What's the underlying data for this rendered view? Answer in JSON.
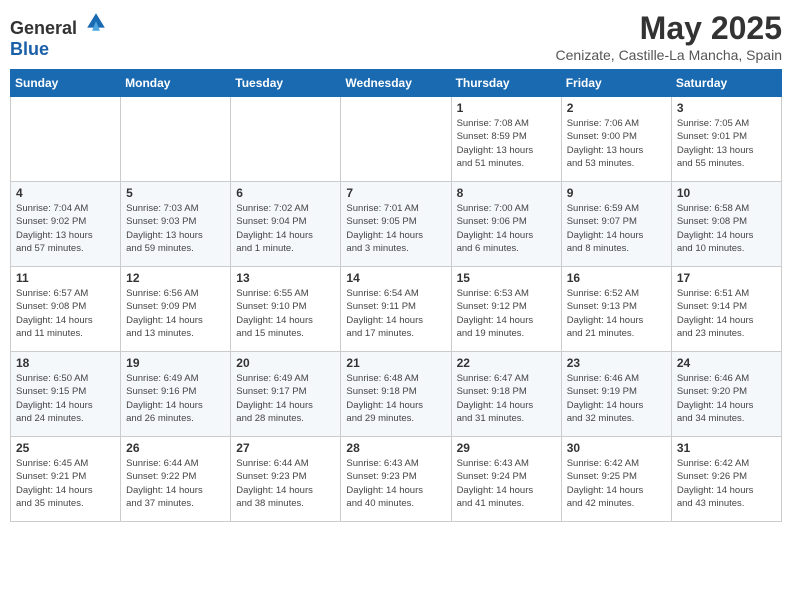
{
  "logo": {
    "general": "General",
    "blue": "Blue"
  },
  "title": "May 2025",
  "location": "Cenizate, Castille-La Mancha, Spain",
  "weekdays": [
    "Sunday",
    "Monday",
    "Tuesday",
    "Wednesday",
    "Thursday",
    "Friday",
    "Saturday"
  ],
  "weeks": [
    [
      {
        "day": "",
        "info": ""
      },
      {
        "day": "",
        "info": ""
      },
      {
        "day": "",
        "info": ""
      },
      {
        "day": "",
        "info": ""
      },
      {
        "day": "1",
        "info": "Sunrise: 7:08 AM\nSunset: 8:59 PM\nDaylight: 13 hours\nand 51 minutes."
      },
      {
        "day": "2",
        "info": "Sunrise: 7:06 AM\nSunset: 9:00 PM\nDaylight: 13 hours\nand 53 minutes."
      },
      {
        "day": "3",
        "info": "Sunrise: 7:05 AM\nSunset: 9:01 PM\nDaylight: 13 hours\nand 55 minutes."
      }
    ],
    [
      {
        "day": "4",
        "info": "Sunrise: 7:04 AM\nSunset: 9:02 PM\nDaylight: 13 hours\nand 57 minutes."
      },
      {
        "day": "5",
        "info": "Sunrise: 7:03 AM\nSunset: 9:03 PM\nDaylight: 13 hours\nand 59 minutes."
      },
      {
        "day": "6",
        "info": "Sunrise: 7:02 AM\nSunset: 9:04 PM\nDaylight: 14 hours\nand 1 minute."
      },
      {
        "day": "7",
        "info": "Sunrise: 7:01 AM\nSunset: 9:05 PM\nDaylight: 14 hours\nand 3 minutes."
      },
      {
        "day": "8",
        "info": "Sunrise: 7:00 AM\nSunset: 9:06 PM\nDaylight: 14 hours\nand 6 minutes."
      },
      {
        "day": "9",
        "info": "Sunrise: 6:59 AM\nSunset: 9:07 PM\nDaylight: 14 hours\nand 8 minutes."
      },
      {
        "day": "10",
        "info": "Sunrise: 6:58 AM\nSunset: 9:08 PM\nDaylight: 14 hours\nand 10 minutes."
      }
    ],
    [
      {
        "day": "11",
        "info": "Sunrise: 6:57 AM\nSunset: 9:08 PM\nDaylight: 14 hours\nand 11 minutes."
      },
      {
        "day": "12",
        "info": "Sunrise: 6:56 AM\nSunset: 9:09 PM\nDaylight: 14 hours\nand 13 minutes."
      },
      {
        "day": "13",
        "info": "Sunrise: 6:55 AM\nSunset: 9:10 PM\nDaylight: 14 hours\nand 15 minutes."
      },
      {
        "day": "14",
        "info": "Sunrise: 6:54 AM\nSunset: 9:11 PM\nDaylight: 14 hours\nand 17 minutes."
      },
      {
        "day": "15",
        "info": "Sunrise: 6:53 AM\nSunset: 9:12 PM\nDaylight: 14 hours\nand 19 minutes."
      },
      {
        "day": "16",
        "info": "Sunrise: 6:52 AM\nSunset: 9:13 PM\nDaylight: 14 hours\nand 21 minutes."
      },
      {
        "day": "17",
        "info": "Sunrise: 6:51 AM\nSunset: 9:14 PM\nDaylight: 14 hours\nand 23 minutes."
      }
    ],
    [
      {
        "day": "18",
        "info": "Sunrise: 6:50 AM\nSunset: 9:15 PM\nDaylight: 14 hours\nand 24 minutes."
      },
      {
        "day": "19",
        "info": "Sunrise: 6:49 AM\nSunset: 9:16 PM\nDaylight: 14 hours\nand 26 minutes."
      },
      {
        "day": "20",
        "info": "Sunrise: 6:49 AM\nSunset: 9:17 PM\nDaylight: 14 hours\nand 28 minutes."
      },
      {
        "day": "21",
        "info": "Sunrise: 6:48 AM\nSunset: 9:18 PM\nDaylight: 14 hours\nand 29 minutes."
      },
      {
        "day": "22",
        "info": "Sunrise: 6:47 AM\nSunset: 9:18 PM\nDaylight: 14 hours\nand 31 minutes."
      },
      {
        "day": "23",
        "info": "Sunrise: 6:46 AM\nSunset: 9:19 PM\nDaylight: 14 hours\nand 32 minutes."
      },
      {
        "day": "24",
        "info": "Sunrise: 6:46 AM\nSunset: 9:20 PM\nDaylight: 14 hours\nand 34 minutes."
      }
    ],
    [
      {
        "day": "25",
        "info": "Sunrise: 6:45 AM\nSunset: 9:21 PM\nDaylight: 14 hours\nand 35 minutes."
      },
      {
        "day": "26",
        "info": "Sunrise: 6:44 AM\nSunset: 9:22 PM\nDaylight: 14 hours\nand 37 minutes."
      },
      {
        "day": "27",
        "info": "Sunrise: 6:44 AM\nSunset: 9:23 PM\nDaylight: 14 hours\nand 38 minutes."
      },
      {
        "day": "28",
        "info": "Sunrise: 6:43 AM\nSunset: 9:23 PM\nDaylight: 14 hours\nand 40 minutes."
      },
      {
        "day": "29",
        "info": "Sunrise: 6:43 AM\nSunset: 9:24 PM\nDaylight: 14 hours\nand 41 minutes."
      },
      {
        "day": "30",
        "info": "Sunrise: 6:42 AM\nSunset: 9:25 PM\nDaylight: 14 hours\nand 42 minutes."
      },
      {
        "day": "31",
        "info": "Sunrise: 6:42 AM\nSunset: 9:26 PM\nDaylight: 14 hours\nand 43 minutes."
      }
    ]
  ]
}
